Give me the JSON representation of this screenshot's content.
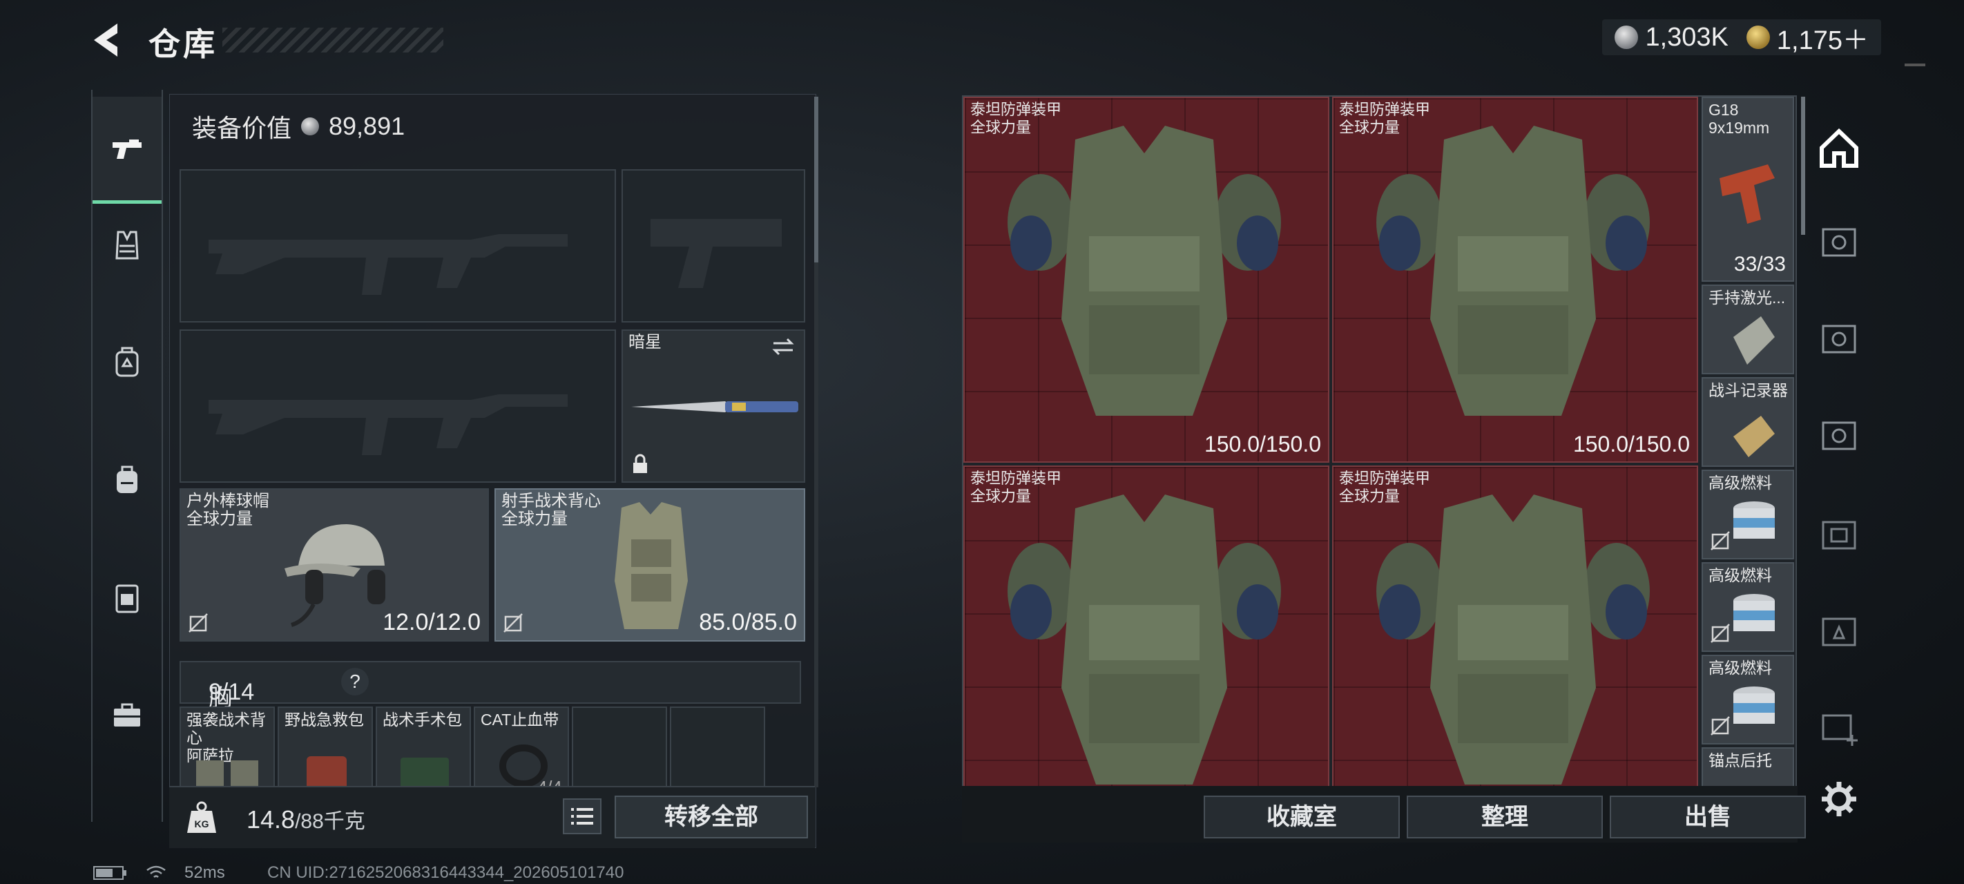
{
  "header": {
    "title": "仓库",
    "currencies": [
      {
        "icon": "silver-coin-icon",
        "value": "1,303K"
      },
      {
        "icon": "gold-coin-icon",
        "value": "1,175＋"
      }
    ]
  },
  "left_rail": {
    "items": [
      {
        "icon": "pistol-icon",
        "active": true
      },
      {
        "icon": "vest-icon",
        "active": false
      },
      {
        "icon": "backpack-outline-icon",
        "active": false
      },
      {
        "icon": "backpack-icon",
        "active": false
      },
      {
        "icon": "case-icon",
        "active": false
      },
      {
        "icon": "toolbox-icon",
        "active": false
      }
    ]
  },
  "equipment": {
    "value_label": "装备价值",
    "value": "89,891",
    "melee": {
      "name": "暗星"
    },
    "helmet": {
      "name": "户外棒球帽",
      "sub": "全球力量",
      "durability": "12.0/12.0"
    },
    "vest": {
      "name": "射手战术背心",
      "sub": "全球力量",
      "durability": "85.0/85.0"
    },
    "chest": {
      "label": "胸挂：",
      "capacity": "9/14",
      "help": "?"
    },
    "chest_items": [
      {
        "name": "强袭战术背心",
        "sub": "阿萨拉"
      },
      {
        "name": "野战急救包"
      },
      {
        "name": "战术手术包"
      },
      {
        "name": "CAT止血带",
        "count": "4/4"
      }
    ]
  },
  "footer": {
    "weight": "14.8",
    "weight_unit": "/88千克",
    "transfer_label": "转移全部"
  },
  "stash": {
    "armors": [
      {
        "name": "泰坦防弹装甲",
        "sub": "全球力量",
        "durability": "150.0/150.0"
      },
      {
        "name": "泰坦防弹装甲",
        "sub": "全球力量",
        "durability": "150.0/150.0"
      },
      {
        "name": "泰坦防弹装甲",
        "sub": "全球力量",
        "durability": ""
      },
      {
        "name": "泰坦防弹装甲",
        "sub": "全球力量",
        "durability": ""
      }
    ],
    "side_items": [
      {
        "name": "G18",
        "sub": "9x19mm",
        "count": "33/33"
      },
      {
        "name": "手持激光..."
      },
      {
        "name": "战斗记录器"
      },
      {
        "name": "高级燃料"
      },
      {
        "name": "高级燃料"
      },
      {
        "name": "高级燃料"
      },
      {
        "name": "锚点后托"
      }
    ],
    "buttons": {
      "collection": "收藏室",
      "sort": "整理",
      "sell": "出售"
    }
  },
  "right_rail": {
    "icons": [
      "home-icon",
      "vault-v-icon",
      "vault-v-icon",
      "vault-v-icon",
      "vault-iv-icon",
      "vault-ii-icon",
      "vault-iv-add-icon",
      "settings-icon"
    ]
  },
  "status": {
    "ping": "52ms",
    "uid": "CN UID:2716252068316443344_202605101740"
  }
}
